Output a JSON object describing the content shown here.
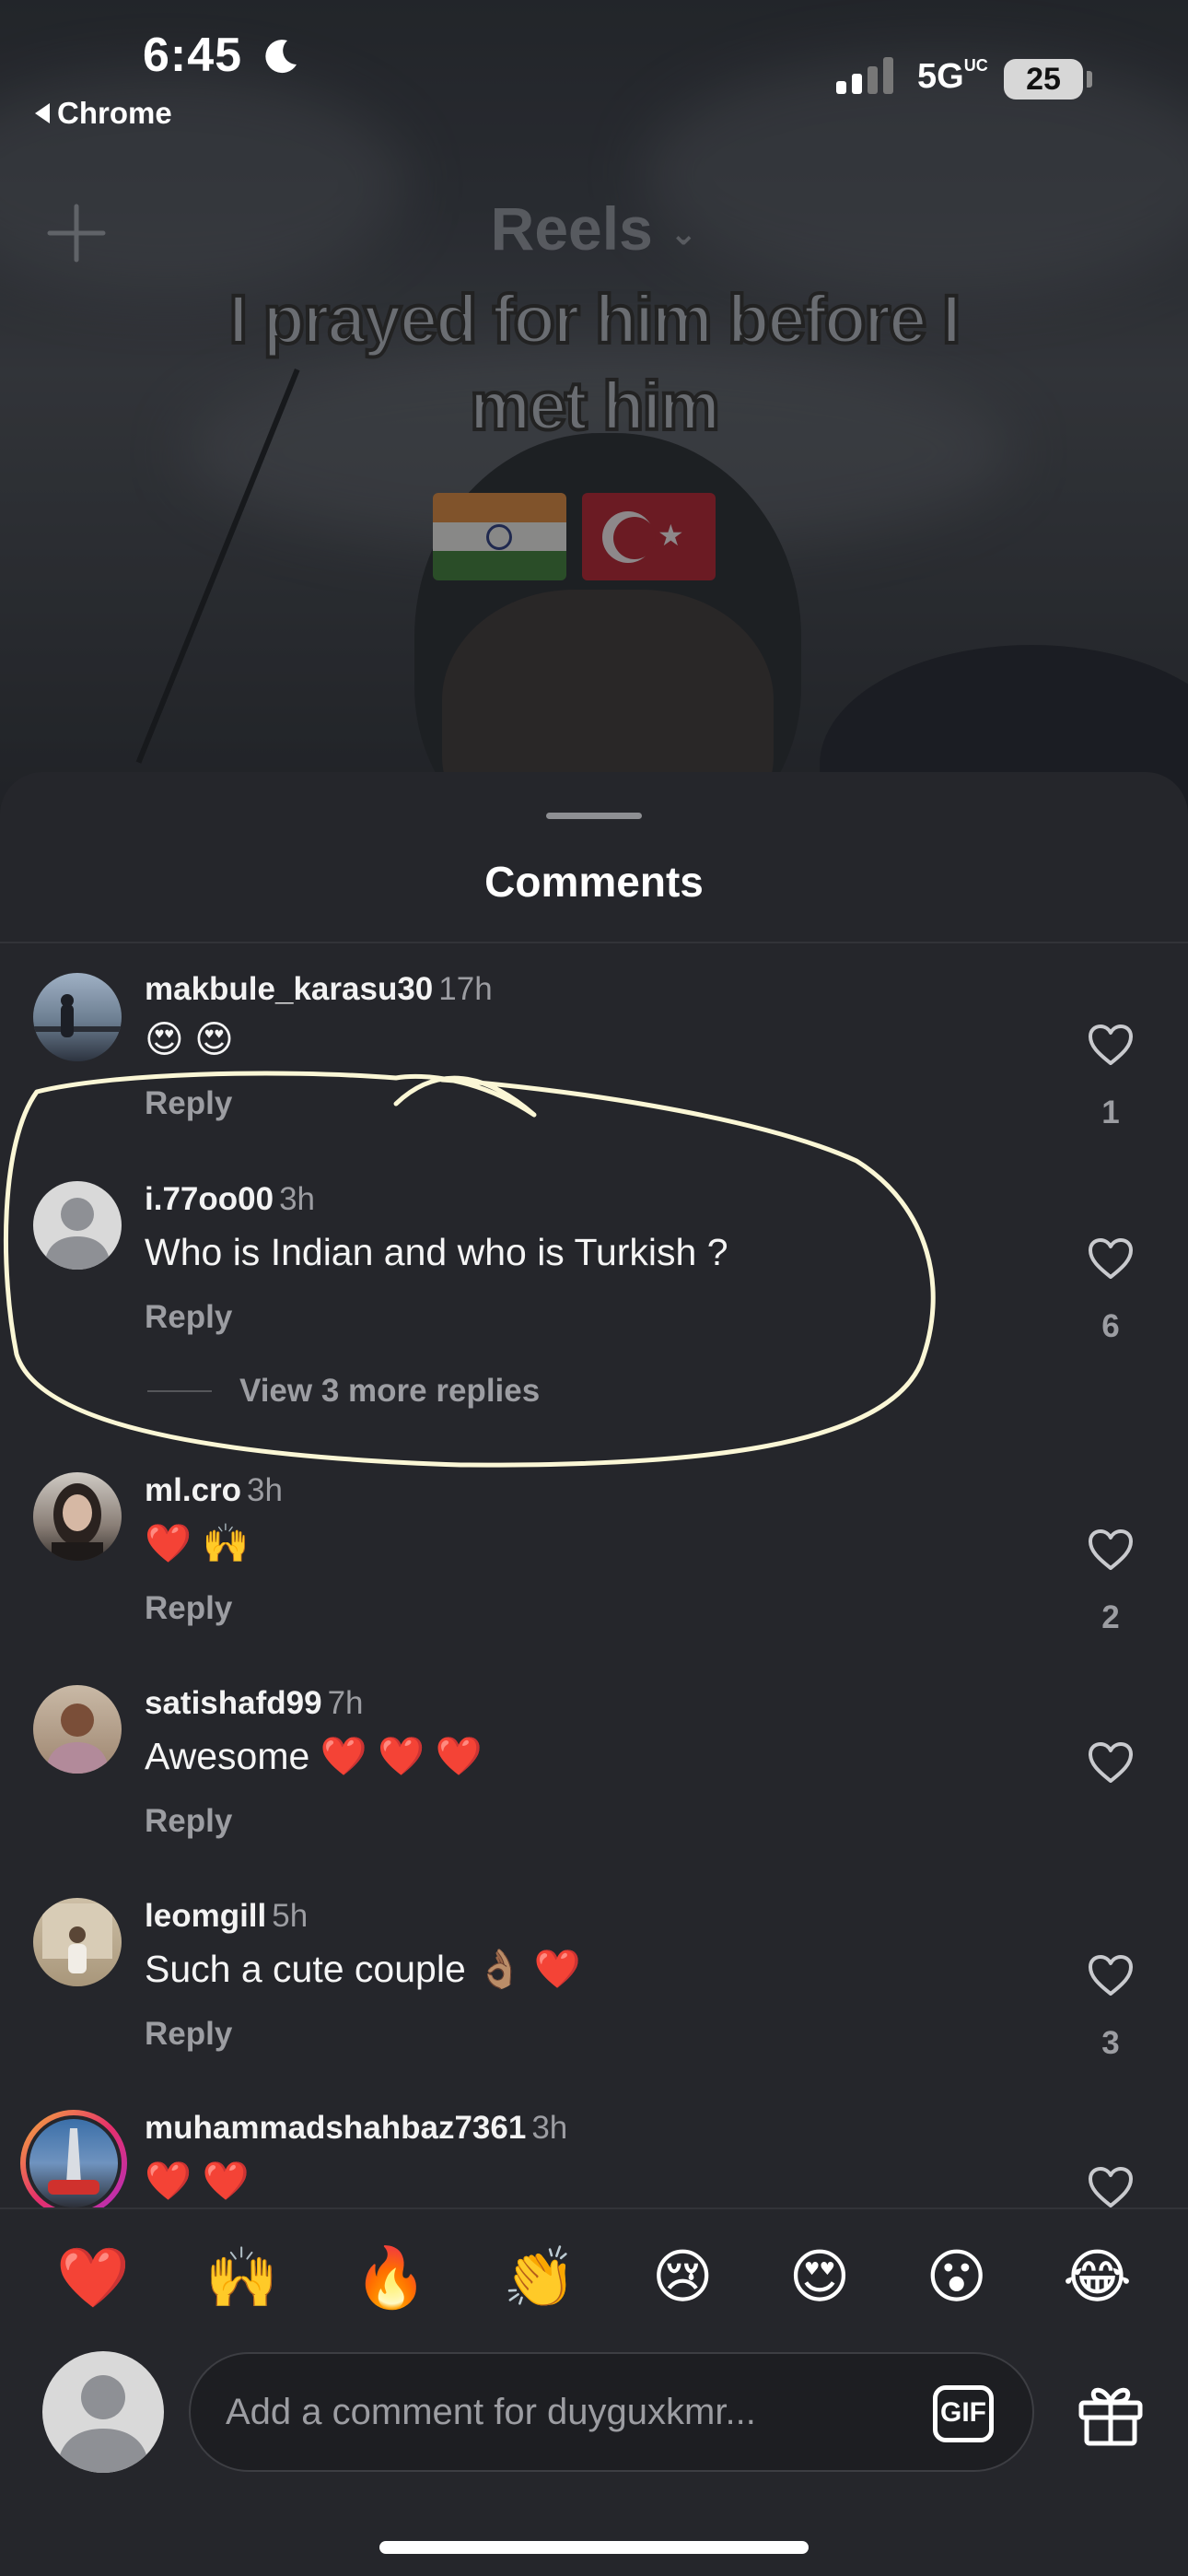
{
  "status_bar": {
    "time": "6:45",
    "back_app": "Chrome",
    "network": "5G",
    "network_suffix": "UC",
    "battery": "25"
  },
  "reel": {
    "title": "Reels",
    "caption": "I prayed for him before I met him"
  },
  "sheet": {
    "title": "Comments"
  },
  "comments": [
    {
      "user": "makbule_karasu30",
      "time": "17h",
      "text": "😍 😍",
      "reply": "Reply",
      "likes": "1"
    },
    {
      "user": "i.77oo00",
      "time": "3h",
      "text": "Who is Indian and who is Turkish ?",
      "reply": "Reply",
      "likes": "6",
      "more_replies": "View 3 more replies"
    },
    {
      "user": "ml.cro",
      "time": "3h",
      "text": "❤️ 🙌",
      "reply": "Reply",
      "likes": "2"
    },
    {
      "user": "satishafd99",
      "time": "7h",
      "text": "Awesome ❤️ ❤️ ❤️",
      "reply": "Reply",
      "likes": ""
    },
    {
      "user": "leomgill",
      "time": "5h",
      "text": "Such a cute couple 👌🏽 ❤️",
      "reply": "Reply",
      "likes": "3"
    },
    {
      "user": "muhammadshahbaz7361",
      "time": "3h",
      "text": "❤️ ❤️",
      "reply": "",
      "likes": ""
    }
  ],
  "quick_emojis": [
    "❤️",
    "🙌",
    "🔥",
    "👏",
    "😢",
    "😍",
    "😮",
    "😂"
  ],
  "composer": {
    "placeholder": "Add a comment for duyguxkmr...",
    "gif_label": "GIF"
  },
  "colors": {
    "sheet_bg": "#25262b",
    "muted_text": "#9c9da2",
    "annotation": "#fbf7d6"
  }
}
